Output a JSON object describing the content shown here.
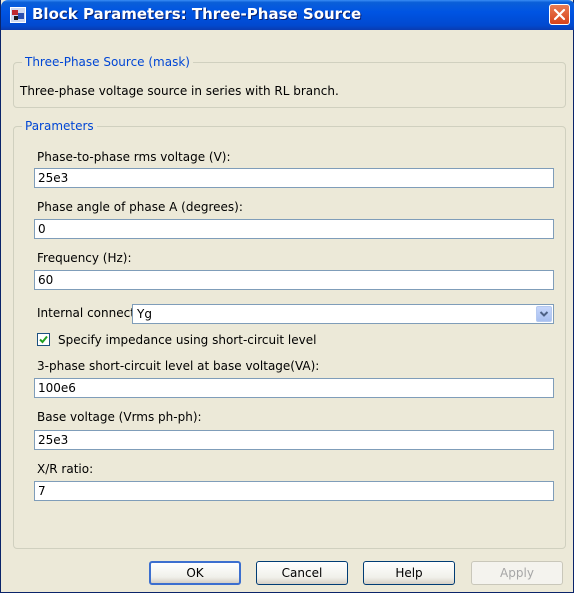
{
  "window": {
    "title": "Block Parameters: Three-Phase Source"
  },
  "mask_group": {
    "legend": "Three-Phase Source (mask)",
    "description": "Three-phase voltage source in series with RL branch."
  },
  "parameters": {
    "legend": "Parameters",
    "phase_voltage": {
      "label": "Phase-to-phase rms voltage (V):",
      "value": "25e3"
    },
    "phase_angle": {
      "label": "Phase angle of phase A (degrees):",
      "value": "0"
    },
    "frequency": {
      "label": "Frequency (Hz):",
      "value": "60"
    },
    "internal_connection": {
      "label": "Internal connection:",
      "value": "Yg"
    },
    "impedance_checkbox": {
      "label": "Specify impedance using short-circuit level",
      "checked": true
    },
    "short_circuit_level": {
      "label": "3-phase short-circuit level at base voltage(VA):",
      "value": "100e6"
    },
    "base_voltage": {
      "label": "Base voltage (Vrms ph-ph):",
      "value": "25e3"
    },
    "xr_ratio": {
      "label": "X/R ratio:",
      "value": "7"
    }
  },
  "buttons": {
    "ok": "OK",
    "cancel": "Cancel",
    "help": "Help",
    "apply": "Apply"
  },
  "colors": {
    "titlebar": "#0054e3",
    "legend_text": "#0046d5",
    "window_bg": "#ece9d8",
    "close_button": "#d8421a"
  },
  "icons": {
    "title_icon": "simulink-block-icon",
    "close": "close-icon",
    "dropdown": "chevron-down-icon",
    "check": "checkmark-icon"
  }
}
